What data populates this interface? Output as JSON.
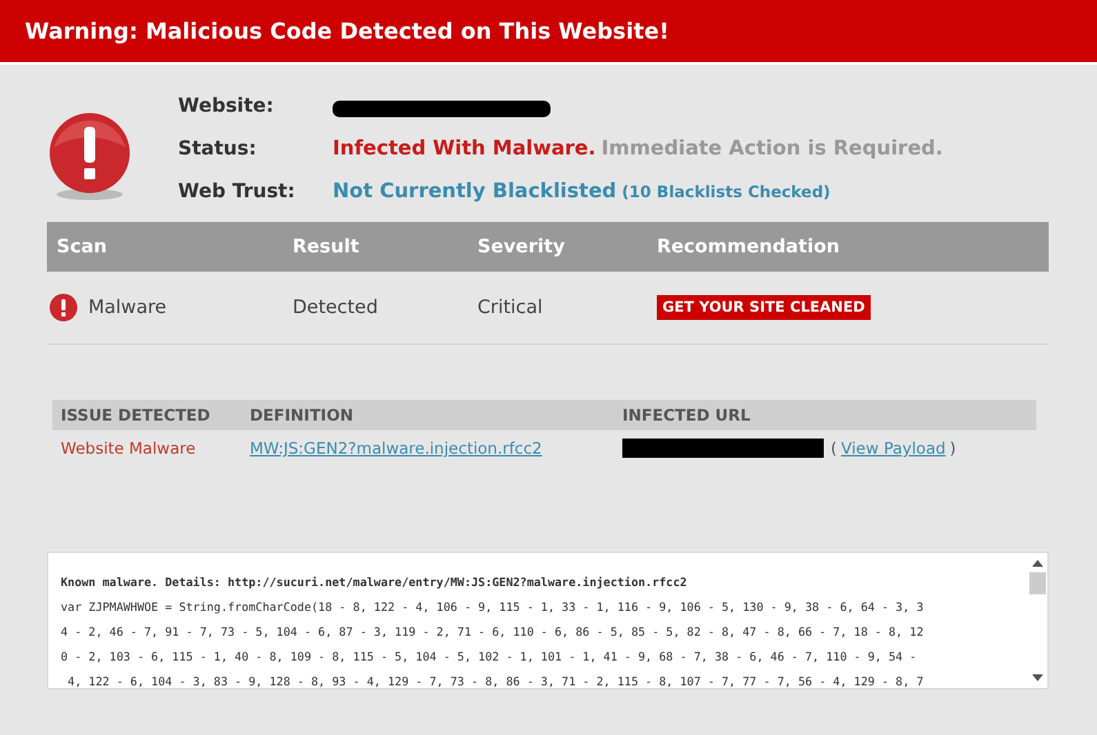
{
  "header": {
    "title": "Warning: Malicious Code Detected on This Website!"
  },
  "summary": [
    {
      "kind": "redacted",
      "label": "Website:"
    },
    {
      "kind": "status",
      "label": "Status:",
      "value": "Infected With Malware.",
      "note": "Immediate Action is Required."
    },
    {
      "kind": "trust",
      "label": "Web Trust:",
      "value": "Not Currently Blacklisted",
      "note": "(10 Blacklists Checked)"
    }
  ],
  "scan_table": {
    "columns": [
      "Scan",
      "Result",
      "Severity",
      "Recommendation"
    ],
    "rows": [
      {
        "scan": "Malware",
        "result": "Detected",
        "severity": "Critical",
        "action": "GET YOUR SITE CLEANED"
      }
    ]
  },
  "issues_table": {
    "columns": [
      "ISSUE DETECTED",
      "DEFINITION",
      "INFECTED URL"
    ],
    "rows": [
      {
        "issue": "Website Malware",
        "definition": "MW:JS:GEN2?malware.injection.rfcc2",
        "open_paren": "(",
        "payload_link": "View Payload",
        "close_paren": ")"
      }
    ]
  },
  "details": {
    "lines": [
      "Known malware. Details: http://sucuri.net/malware/entry/MW:JS:GEN2?malware.injection.rfcc2",
      "var ZJPMAWHWOE = String.fromCharCode(18 - 8, 122 - 4, 106 - 9, 115 - 1, 33 - 1, 116 - 9, 106 - 5, 130 - 9, 38 - 6, 64 - 3, 3",
      "4 - 2, 46 - 7, 91 - 7, 73 - 5, 104 - 6, 87 - 3, 119 - 2, 71 - 6, 110 - 6, 86 - 5, 85 - 5, 82 - 8, 47 - 8, 66 - 7, 18 - 8, 12",
      "0 - 2, 103 - 6, 115 - 1, 40 - 8, 109 - 8, 115 - 5, 104 - 5, 102 - 1, 101 - 1, 41 - 9, 68 - 7, 38 - 6, 46 - 7, 110 - 9, 54 -",
      " 4, 122 - 6, 104 - 3, 83 - 9, 128 - 8, 93 - 4, 129 - 7, 73 - 8, 86 - 3, 71 - 2, 115 - 8, 107 - 7, 77 - 7, 56 - 4, 129 - 8, 7"
    ]
  }
}
